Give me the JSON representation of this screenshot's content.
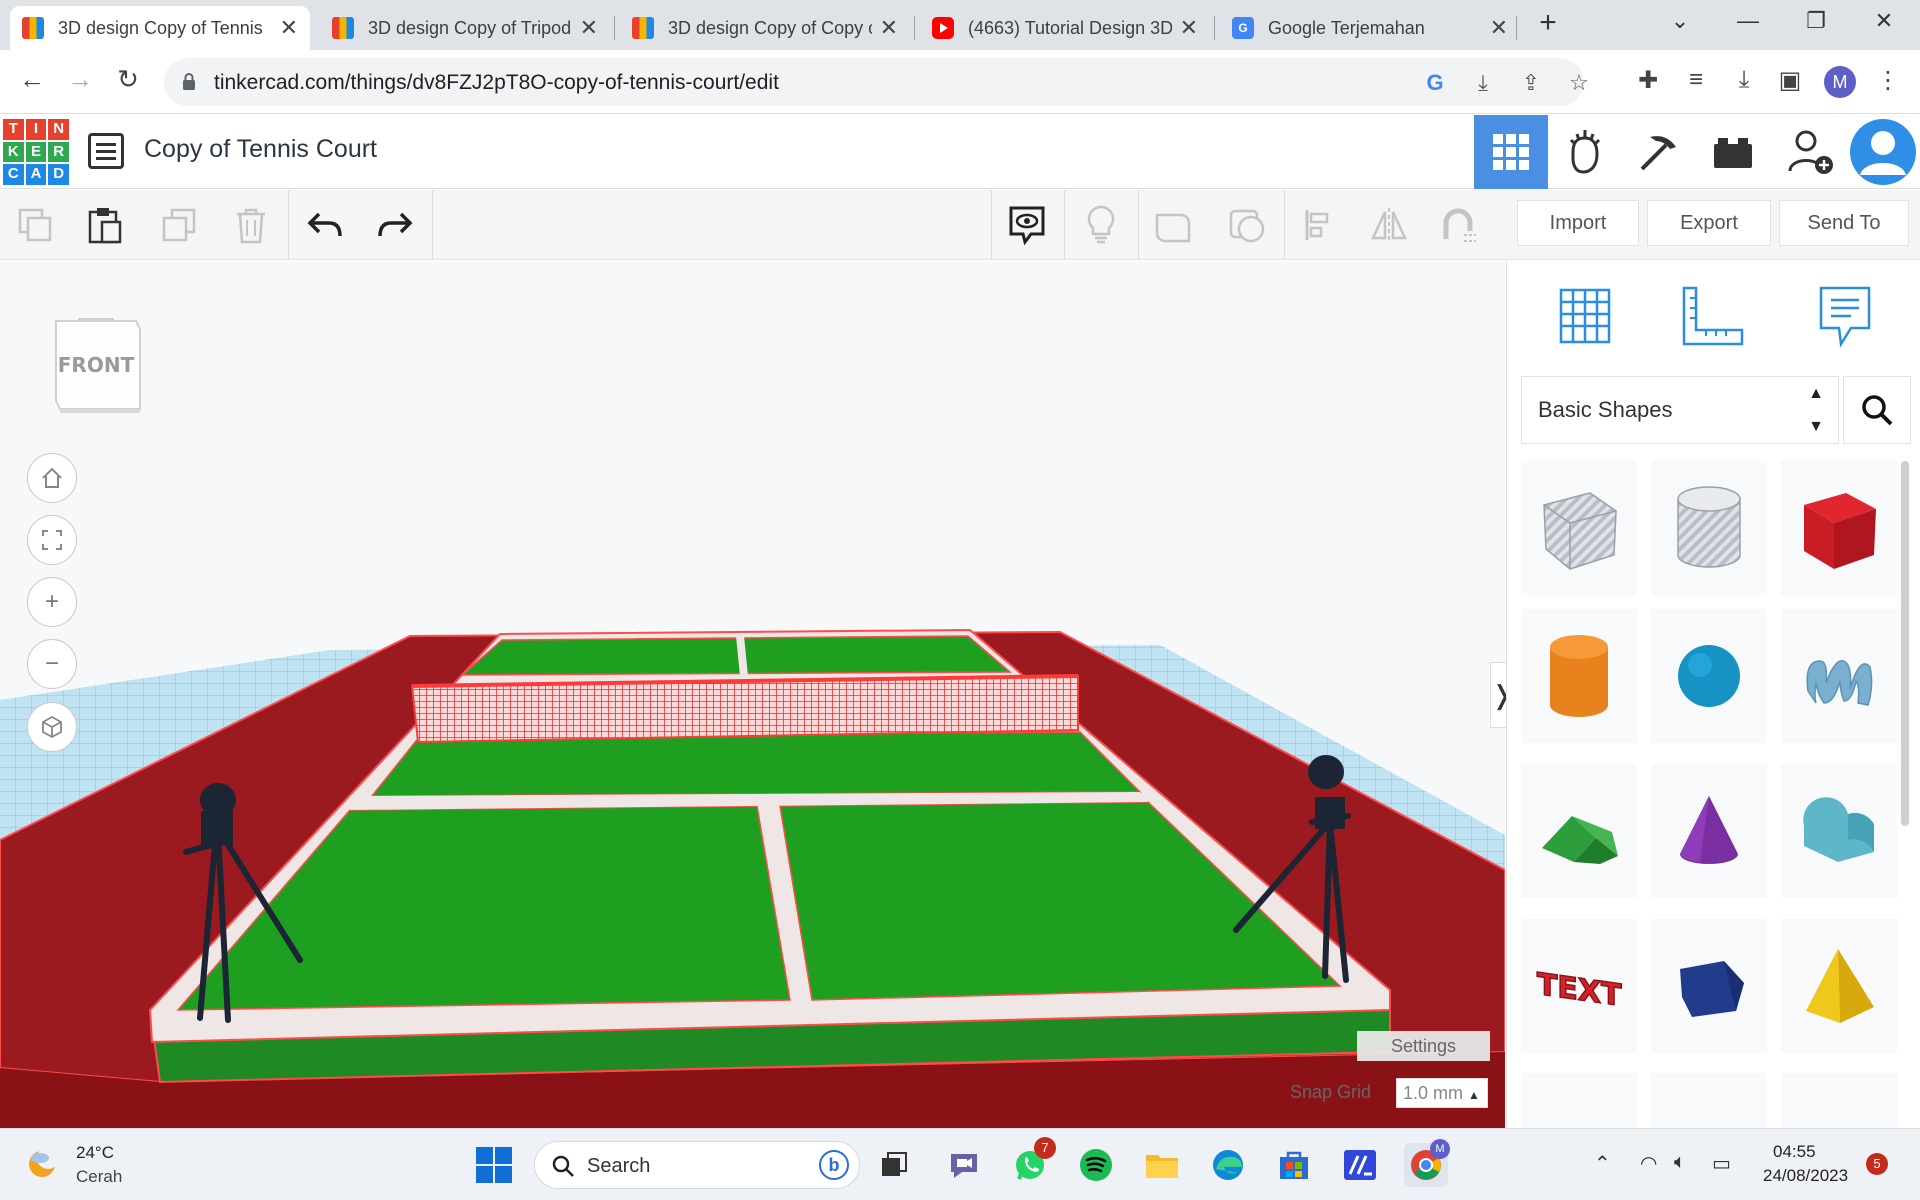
{
  "browser": {
    "tabs": [
      {
        "title": "3D design Copy of Tennis",
        "favicon": "tinkercad-icon",
        "active": true
      },
      {
        "title": "3D design Copy of Tripod",
        "favicon": "tinkercad-icon",
        "active": false
      },
      {
        "title": "3D design Copy of Copy o",
        "favicon": "tinkercad-icon",
        "active": false
      },
      {
        "title": "(4663) Tutorial Design 3D",
        "favicon": "youtube-icon",
        "active": false
      },
      {
        "title": "Google Terjemahan",
        "favicon": "google-translate-icon",
        "active": false
      }
    ],
    "new_tab": "+",
    "url": "tinkercad.com/things/dv8FZJ2pT8O-copy-of-tennis-court/edit",
    "profile_initial": "M"
  },
  "tinkercad": {
    "logo_letters": [
      "T",
      "I",
      "N",
      "K",
      "E",
      "R",
      "C",
      "A",
      "D"
    ],
    "logo_colors": [
      "#e5412d",
      "#e5412d",
      "#e5412d",
      "#2fa84f",
      "#2fa84f",
      "#2fa84f",
      "#1e88e5",
      "#1e88e5",
      "#1e88e5"
    ],
    "design_title": "Copy of Tennis Court",
    "import_label": "Import",
    "export_label": "Export",
    "sendto_label": "Send To",
    "accent_color": "#4a90e2"
  },
  "viewport": {
    "viewcube_label": "FRONT",
    "settings_label": "Settings",
    "snap_grid_label": "Snap Grid",
    "snap_grid_value": "1.0 mm",
    "expand_glyph": "❭"
  },
  "panel": {
    "category": "Basic Shapes",
    "shapes": [
      "box-hole",
      "cylinder-hole",
      "box",
      "cylinder",
      "sphere",
      "scribble",
      "roof",
      "cone",
      "round-roof",
      "text",
      "polygon",
      "pyramid"
    ]
  },
  "taskbar": {
    "weather_temp": "24°C",
    "weather_desc": "Cerah",
    "search_label": "Search",
    "whatsapp_badge": "7",
    "time": "04:55",
    "date": "24/08/2023",
    "notifications": "5",
    "chrome_profile": "M"
  }
}
